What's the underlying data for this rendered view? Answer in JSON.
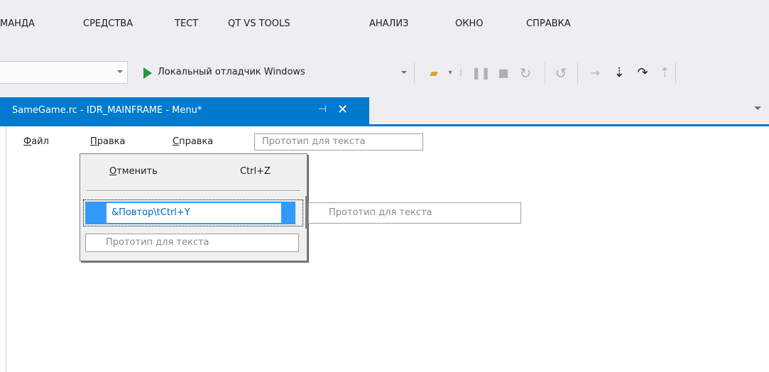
{
  "menubar": {
    "items": [
      "МАНДА",
      "СРЕДСТВА",
      "ТЕСТ",
      "QT VS TOOLS",
      "АНАЛИЗ",
      "ОКНО",
      "СПРАВКА"
    ]
  },
  "toolbar": {
    "debugger_label": "Локальный отладчик Windows",
    "icons": [
      "play-icon",
      "folder-icon",
      "pause-icon",
      "stop-icon",
      "restart-icon",
      "step-into-icon",
      "step-over-icon",
      "step-out-icon"
    ]
  },
  "tab": {
    "title": "SameGame.rc - IDR_MAINFRAME - Menu*",
    "pin": "⊣",
    "close": "✕"
  },
  "resource_menu": {
    "items": [
      {
        "hotkey": "Ф",
        "rest": "айл"
      },
      {
        "hotkey": "П",
        "rest": "равка"
      },
      {
        "hotkey": "С",
        "rest": "правка"
      }
    ],
    "placeholder": "Прототип для текста"
  },
  "dropdown": {
    "undo_hotkey": "О",
    "undo_rest": "тменить",
    "undo_shortcut": "Ctrl+Z",
    "editing_value": "&Повтор\\tCtrl+Y",
    "placeholder": "Прототип для текста"
  },
  "submenu": {
    "placeholder": "Прототип для текста"
  },
  "colors": {
    "accent": "#007acc",
    "selection": "#3399ff",
    "play": "#1e9a36"
  }
}
